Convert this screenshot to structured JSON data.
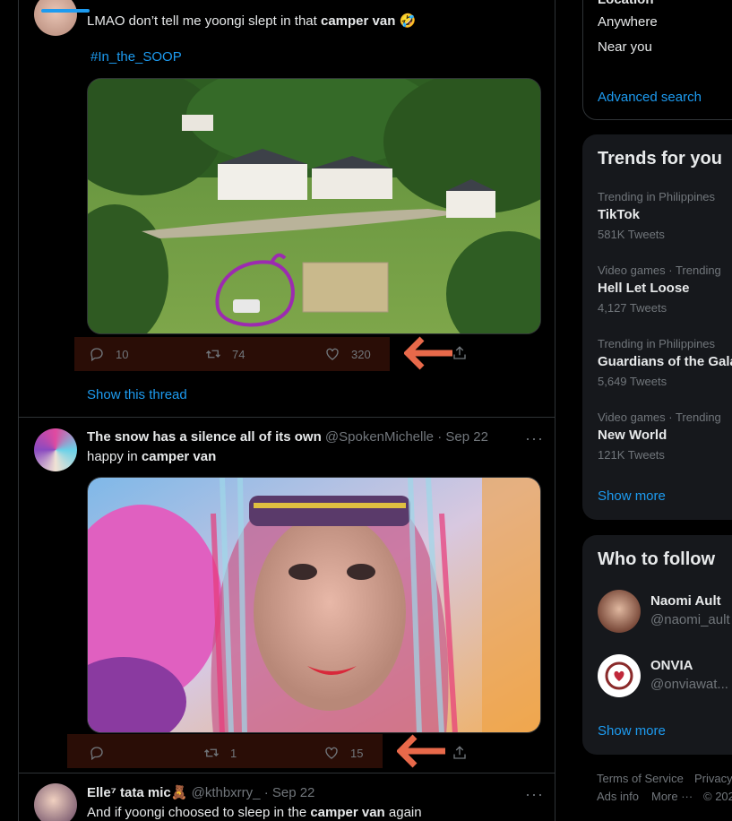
{
  "tweet1": {
    "text_before": "LMAO don’t tell me yoongi slept in that ",
    "text_bold": "camper van",
    "emoji": "🤣",
    "hashtag": "#In_the_SOOP",
    "replies": "10",
    "retweets": "74",
    "likes": "320",
    "show_thread": "Show this thread"
  },
  "tweet2": {
    "name": "The snow has a silence all of its own",
    "handle": "@SpokenMichelle",
    "dot": "·",
    "date": "Sep 22",
    "text_before": "happy in ",
    "text_bold": "camper van",
    "replies": "",
    "retweets": "1",
    "likes": "15"
  },
  "tweet3": {
    "name": "Elle⁷ tata mic",
    "name_emoji": "🧸",
    "handle": "@kthbxrry_",
    "dot": "·",
    "date": "Sep 22",
    "text_before": "And if yoongi choosed to sleep in the ",
    "text_bold": "camper van",
    "text_after": " again"
  },
  "search_filters": {
    "location_label": "Location",
    "anywhere": "Anywhere",
    "near_you": "Near you",
    "advanced": "Advanced search"
  },
  "trends": {
    "title": "Trends for you",
    "items": [
      {
        "meta": "Trending in Philippines",
        "name": "TikTok",
        "count": "581K Tweets"
      },
      {
        "meta": "Video games · Trending",
        "name": "Hell Let Loose",
        "count": "4,127 Tweets"
      },
      {
        "meta": "Trending in Philippines",
        "name": "Guardians of the Gala",
        "count": "5,649 Tweets"
      },
      {
        "meta": "Video games · Trending",
        "name": "New World",
        "count": "121K Tweets"
      }
    ],
    "show_more": "Show more"
  },
  "who_to_follow": {
    "title": "Who to follow",
    "items": [
      {
        "name": "Naomi Ault",
        "handle": "@naomi_ault"
      },
      {
        "name": "ONVIA",
        "handle": "@onviawat..."
      }
    ],
    "show_more": "Show more"
  },
  "footer": {
    "terms": "Terms of Service",
    "privacy": "Privacy",
    "ads": "Ads info",
    "more": "More ···",
    "copyright": "© 202"
  },
  "colors": {
    "accent": "#1d9bf0",
    "highlight_bar": "#2a0d06",
    "arrow": "#e8694a",
    "background": "#000000",
    "panel": "#16181c"
  },
  "icons": [
    "reply-icon",
    "retweet-icon",
    "like-icon",
    "share-icon",
    "more-icon",
    "arrow-left-icon"
  ]
}
